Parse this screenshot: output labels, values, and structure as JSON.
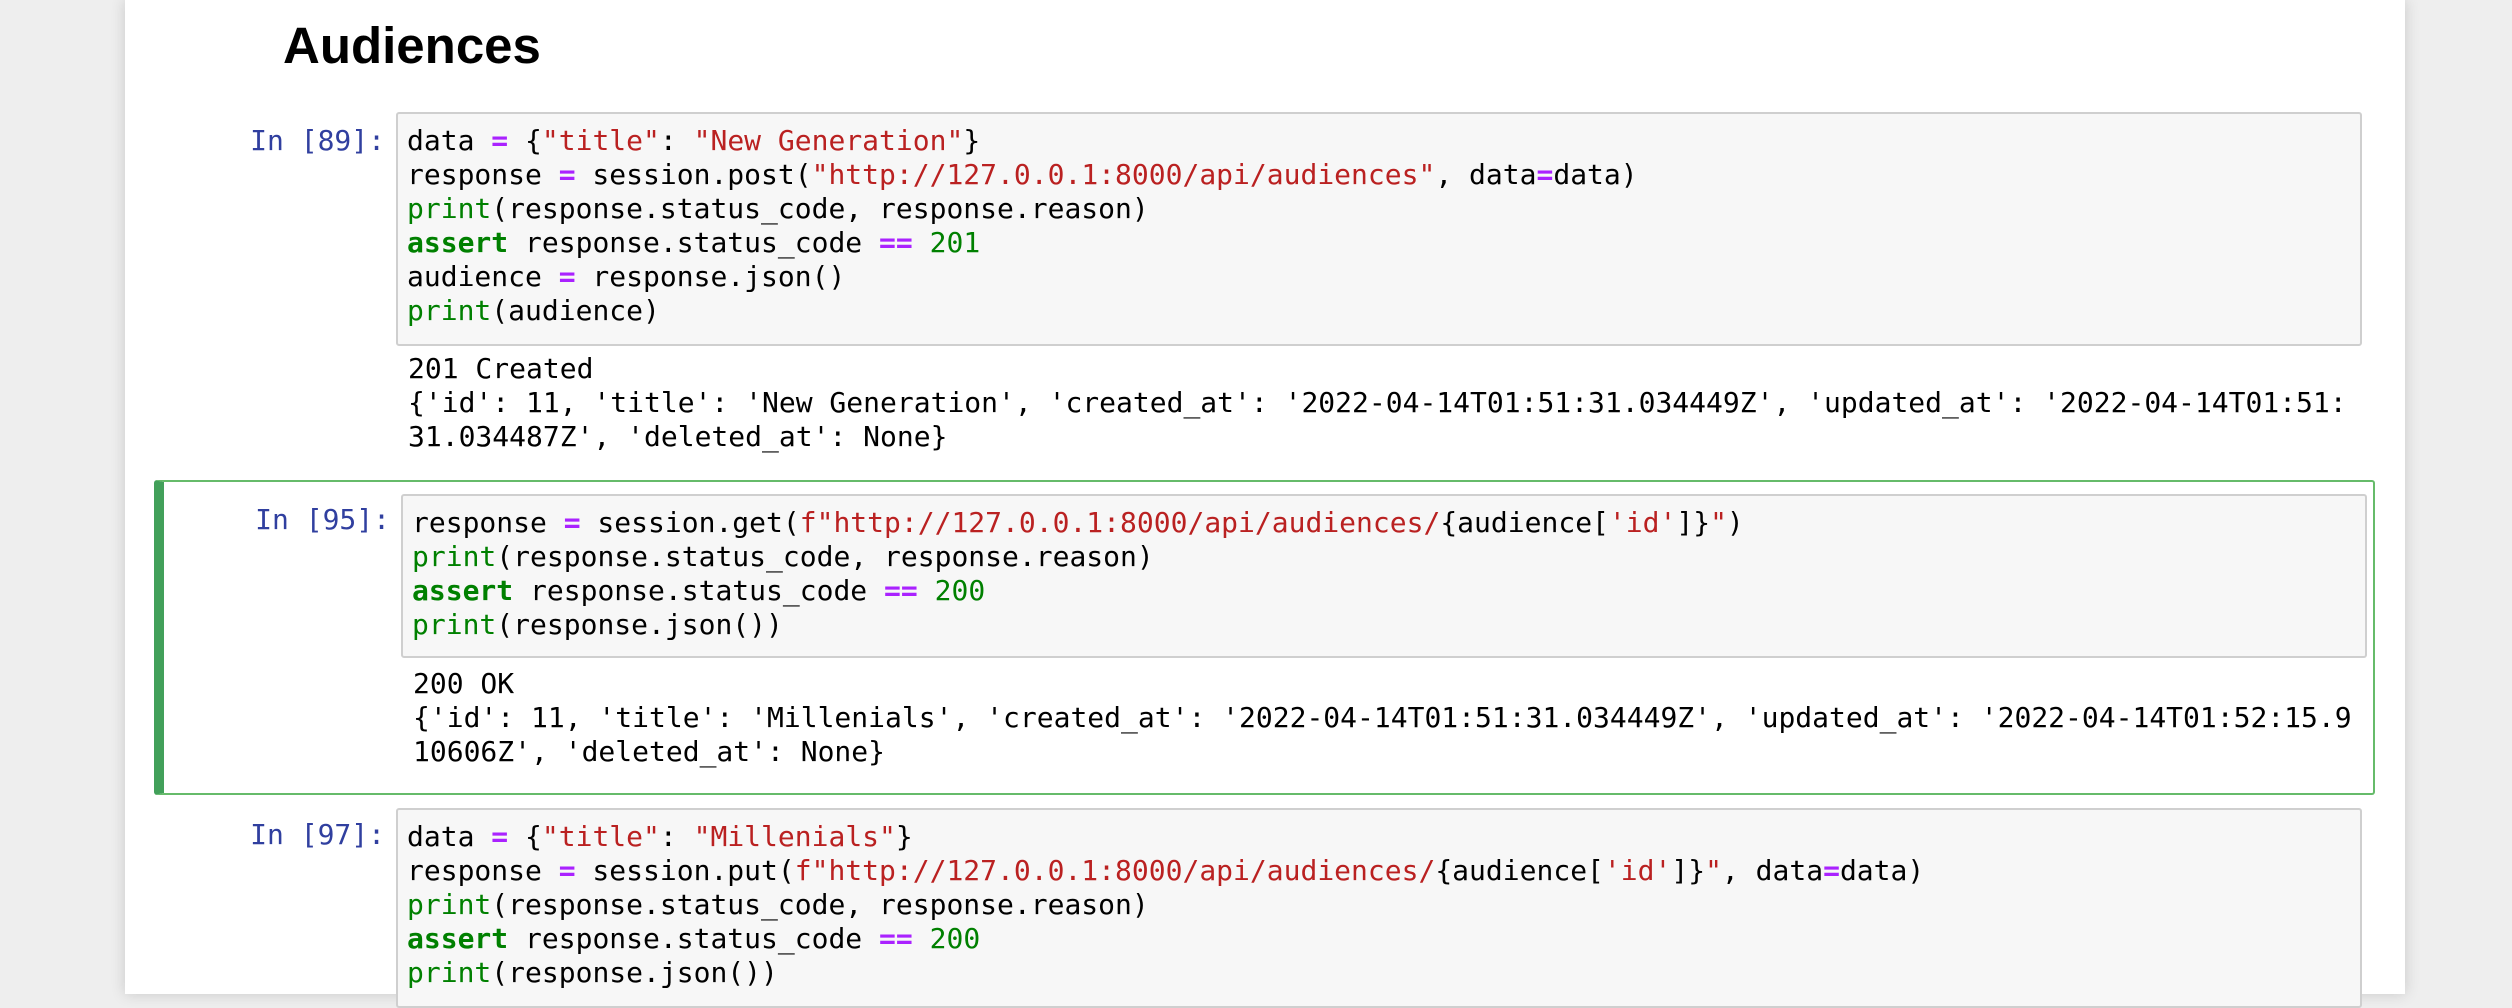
{
  "heading": "Audiences",
  "cells": [
    {
      "prompt": "In [89]:",
      "selected": false,
      "lines": [
        [
          [
            "n",
            "data "
          ],
          [
            "o",
            "="
          ],
          [
            "n",
            " {"
          ],
          [
            "s",
            "\"title\""
          ],
          [
            "n",
            ": "
          ],
          [
            "s",
            "\"New Generation\""
          ],
          [
            "n",
            "}"
          ]
        ],
        [
          [
            "n",
            "response "
          ],
          [
            "o",
            "="
          ],
          [
            "n",
            " session.post("
          ],
          [
            "s",
            "\"http://127.0.0.1:8000/api/audiences\""
          ],
          [
            "n",
            ", data"
          ],
          [
            "o",
            "="
          ],
          [
            "n",
            "data)"
          ]
        ],
        [
          [
            "b",
            "print"
          ],
          [
            "n",
            "(response.status_code, response.reason)"
          ]
        ],
        [
          [
            "k",
            "assert"
          ],
          [
            "n",
            " response.status_code "
          ],
          [
            "o",
            "=="
          ],
          [
            "n",
            " "
          ],
          [
            "m",
            "201"
          ]
        ],
        [
          [
            "n",
            "audience "
          ],
          [
            "o",
            "="
          ],
          [
            "n",
            " response.json()"
          ]
        ],
        [
          [
            "b",
            "print"
          ],
          [
            "n",
            "(audience)"
          ]
        ]
      ],
      "output": [
        "201 Created",
        "{'id': 11, 'title': 'New Generation', 'created_at': '2022-04-14T01:51:31.034449Z', 'updated_at': '2022-04-14T01:51:",
        "31.034487Z', 'deleted_at': None}"
      ]
    },
    {
      "prompt": "In [95]:",
      "selected": true,
      "lines": [
        [
          [
            "n",
            "response "
          ],
          [
            "o",
            "="
          ],
          [
            "n",
            " session.get("
          ],
          [
            "s",
            "f\"http://127.0.0.1:8000/api/audiences/"
          ],
          [
            "n",
            "{audience["
          ],
          [
            "s",
            "'id'"
          ],
          [
            "n",
            "]}"
          ],
          [
            "s",
            "\""
          ],
          [
            "n",
            ")"
          ]
        ],
        [
          [
            "b",
            "print"
          ],
          [
            "n",
            "(response.status_code, response.reason)"
          ]
        ],
        [
          [
            "k",
            "assert"
          ],
          [
            "n",
            " response.status_code "
          ],
          [
            "o",
            "=="
          ],
          [
            "n",
            " "
          ],
          [
            "m",
            "200"
          ]
        ],
        [
          [
            "b",
            "print"
          ],
          [
            "n",
            "(response.json())"
          ]
        ]
      ],
      "output": [
        "200 OK",
        "{'id': 11, 'title': 'Millenials', 'created_at': '2022-04-14T01:51:31.034449Z', 'updated_at': '2022-04-14T01:52:15.9",
        "10606Z', 'deleted_at': None}"
      ]
    },
    {
      "prompt": "In [97]:",
      "selected": false,
      "lines": [
        [
          [
            "n",
            "data "
          ],
          [
            "o",
            "="
          ],
          [
            "n",
            " {"
          ],
          [
            "s",
            "\"title\""
          ],
          [
            "n",
            ": "
          ],
          [
            "s",
            "\"Millenials\""
          ],
          [
            "n",
            "}"
          ]
        ],
        [
          [
            "n",
            "response "
          ],
          [
            "o",
            "="
          ],
          [
            "n",
            " session.put("
          ],
          [
            "s",
            "f\"http://127.0.0.1:8000/api/audiences/"
          ],
          [
            "n",
            "{audience["
          ],
          [
            "s",
            "'id'"
          ],
          [
            "n",
            "]}"
          ],
          [
            "s",
            "\""
          ],
          [
            "n",
            ", data"
          ],
          [
            "o",
            "="
          ],
          [
            "n",
            "data)"
          ]
        ],
        [
          [
            "b",
            "print"
          ],
          [
            "n",
            "(response.status_code, response.reason)"
          ]
        ],
        [
          [
            "k",
            "assert"
          ],
          [
            "n",
            " response.status_code "
          ],
          [
            "o",
            "=="
          ],
          [
            "n",
            " "
          ],
          [
            "m",
            "200"
          ]
        ],
        [
          [
            "b",
            "print"
          ],
          [
            "n",
            "(response.json())"
          ]
        ]
      ],
      "output": []
    }
  ]
}
